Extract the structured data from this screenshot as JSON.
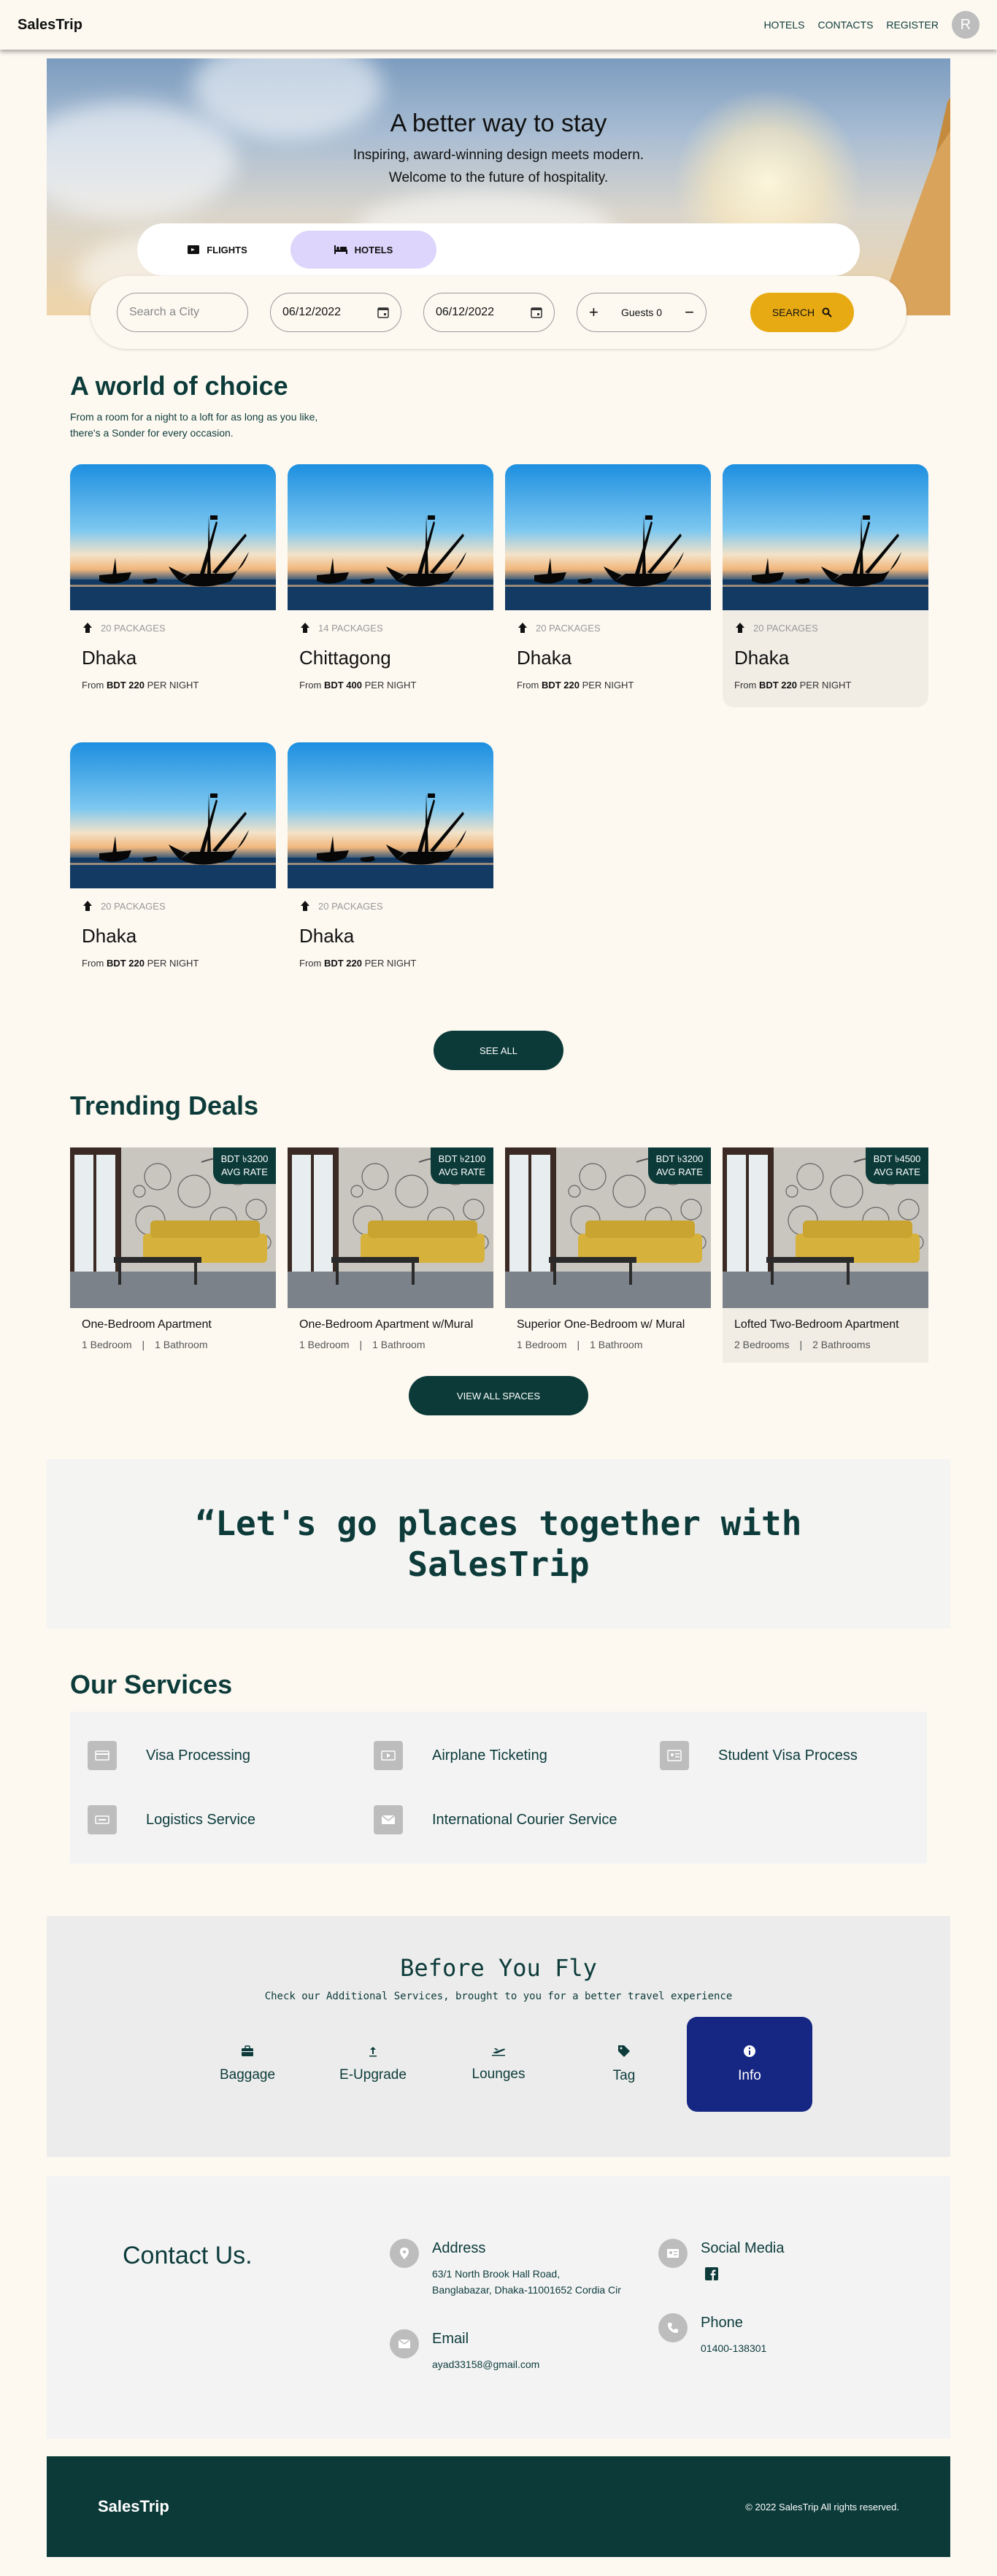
{
  "nav": {
    "brand": "SalesTrip",
    "links": [
      "HOTELS",
      "CONTACTS",
      "REGISTER"
    ],
    "avatar_initial": "R"
  },
  "hero": {
    "title": "A better way to stay",
    "line1": "Inspiring, award-winning design meets modern.",
    "line2": "Welcome to the future of hospitality.",
    "tabs": [
      "FLIGHTS",
      "HOTELS"
    ],
    "active_tab": "HOTELS"
  },
  "search": {
    "city_placeholder": "Search a City",
    "checkin": "06/12/2022",
    "checkout": "06/12/2022",
    "guests_label": "Guests 0",
    "plus": "+",
    "minus": "−",
    "button": "SEARCH"
  },
  "world": {
    "title": "A world of choice",
    "subtitle": "From a room for a night to a loft for as long as you like, there's a Sonder for every occasion.",
    "cards": [
      {
        "packages": "20 PACKAGES",
        "city": "Dhaka",
        "price_prefix": "From ",
        "price": "BDT 220",
        "price_suffix": " PER NIGHT"
      },
      {
        "packages": "14 PACKAGES",
        "city": "Chittagong",
        "price_prefix": "From ",
        "price": "BDT 400",
        "price_suffix": " PER NIGHT"
      },
      {
        "packages": "20 PACKAGES",
        "city": "Dhaka",
        "price_prefix": "From ",
        "price": "BDT 220",
        "price_suffix": " PER NIGHT"
      },
      {
        "packages": "20 PACKAGES",
        "city": "Dhaka",
        "price_prefix": "From ",
        "price": "BDT 220",
        "price_suffix": " PER NIGHT"
      },
      {
        "packages": "20 PACKAGES",
        "city": "Dhaka",
        "price_prefix": "From ",
        "price": "BDT 220",
        "price_suffix": " PER NIGHT"
      },
      {
        "packages": "20 PACKAGES",
        "city": "Dhaka",
        "price_prefix": "From ",
        "price": "BDT 220",
        "price_suffix": " PER NIGHT"
      }
    ],
    "see_all": "SEE ALL"
  },
  "deals": {
    "title": "Trending Deals",
    "cards": [
      {
        "price": "BDT ৳3200",
        "rate": "AVG RATE",
        "name": "One-Bedroom Apartment",
        "beds": "1 Bedroom",
        "baths": "1 Bathroom"
      },
      {
        "price": "BDT ৳2100",
        "rate": "AVG RATE",
        "name": "One-Bedroom Apartment w/Mural",
        "beds": "1 Bedroom",
        "baths": "1 Bathroom"
      },
      {
        "price": "BDT ৳3200",
        "rate": "AVG RATE",
        "name": "Superior One-Bedroom w/ Mural",
        "beds": "1 Bedroom",
        "baths": "1 Bathroom"
      },
      {
        "price": "BDT ৳4500",
        "rate": "AVG RATE",
        "name": "Lofted Two-Bedroom Apartment",
        "beds": "2 Bedrooms",
        "baths": "2 Bathrooms"
      }
    ],
    "separator": "|",
    "view_all": "VIEW ALL SPACES"
  },
  "quote": "“Let's go places together with SalesTrip",
  "services": {
    "title": "Our Services",
    "items": [
      "Visa Processing",
      "Airplane Ticketing",
      "Student Visa Process",
      "Logistics Service",
      "International Courier Service"
    ]
  },
  "before_fly": {
    "title": "Before You Fly",
    "subtitle": "Check our Additional Services, brought to you for a better travel experience",
    "items": [
      "Baggage",
      "E-Upgrade",
      "Lounges",
      "Tag",
      "Info"
    ],
    "active": "Info"
  },
  "contact": {
    "title": "Contact Us.",
    "address_label": "Address",
    "address": "63/1 North Brook Hall Road, Banglabazar, Dhaka-11001652 Cordia Cir",
    "email_label": "Email",
    "email": "ayad33158@gmail.com",
    "social_label": "Social Media",
    "phone_label": "Phone",
    "phone": "01400-138301"
  },
  "footer": {
    "brand": "SalesTrip",
    "copyright": "© 2022 SalesTrip All rights reserved."
  },
  "colors": {
    "page_bg": "#fdf9f1",
    "brand_dark": "#0b3a38",
    "accent_yellow": "#e8aa13",
    "active_tab": "#ddd5fb",
    "info_blue": "#152683"
  }
}
